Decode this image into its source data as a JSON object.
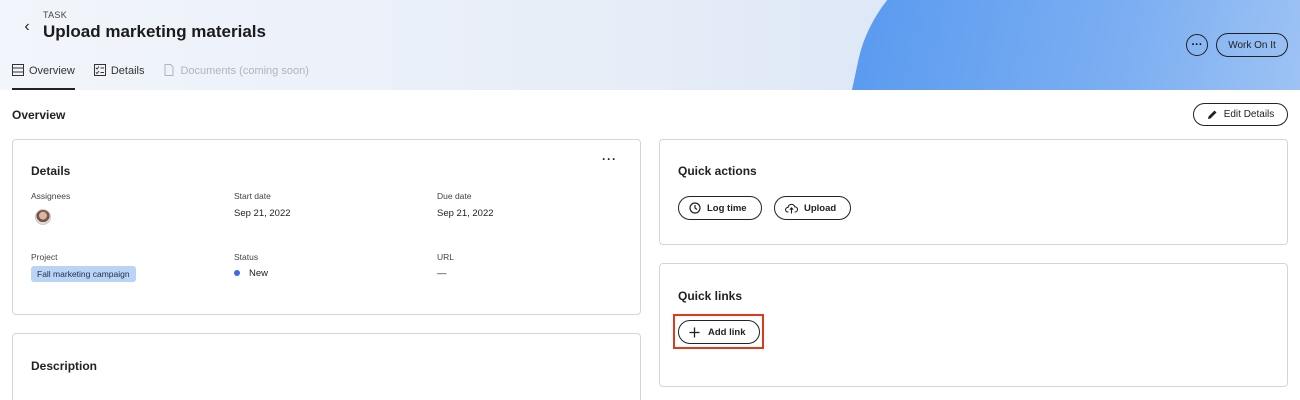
{
  "header": {
    "eyebrow": "TASK",
    "title": "Upload marketing materials",
    "tabs": [
      {
        "label": "Overview",
        "icon": "list-icon",
        "active": true
      },
      {
        "label": "Details",
        "icon": "checklist-icon",
        "active": false
      },
      {
        "label": "Documents (coming soon)",
        "icon": "document-icon",
        "disabled": true
      }
    ],
    "more_label": "···",
    "work_label": "Work On It"
  },
  "overview": {
    "title": "Overview",
    "edit_label": "Edit Details"
  },
  "details_card": {
    "title": "Details",
    "more_label": "···",
    "assignees_label": "Assignees",
    "start_label": "Start date",
    "start_value": "Sep 21, 2022",
    "due_label": "Due date",
    "due_value": "Sep 21, 2022",
    "project_label": "Project",
    "project_value": "Fall marketing campaign",
    "status_label": "Status",
    "status_value": "New",
    "status_color": "#3f6ae0",
    "url_label": "URL",
    "url_value": "—"
  },
  "description_card": {
    "title": "Description"
  },
  "quick_actions": {
    "title": "Quick actions",
    "log_time": "Log time",
    "upload": "Upload"
  },
  "quick_links": {
    "title": "Quick links",
    "add_link": "Add link"
  }
}
